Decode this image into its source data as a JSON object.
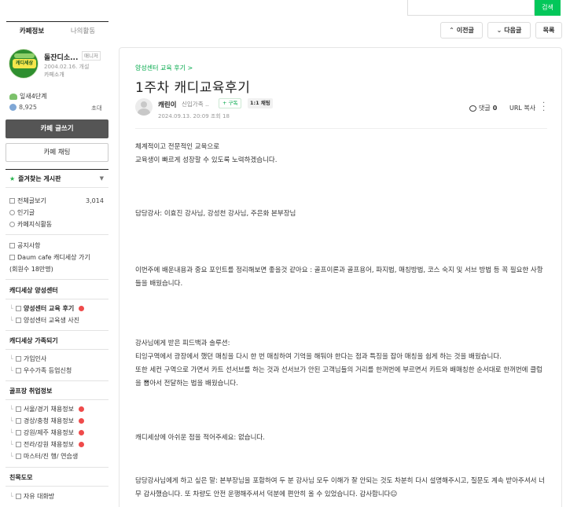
{
  "top": {
    "search_button": "검색",
    "prev_label": "이전글",
    "next_label": "다음글",
    "list_label": "목록"
  },
  "sidebar": {
    "tabs": [
      "카페정보",
      "나의활동"
    ],
    "cafe": {
      "name": "돌잔디소...",
      "badge": "매니저",
      "logo_text": "캐디세상",
      "date": "2004.02.16. 개설",
      "intro": "카페소개"
    },
    "level": "잎새4단계",
    "members": "8,925",
    "invite": "초대",
    "write_button": "카페 글쓰기",
    "chat_button": "카페 채팅",
    "favorites": "즐겨찾는 게시판",
    "menu_top": [
      {
        "label": "전체글보기",
        "count": "3,014"
      },
      {
        "label": "인기글"
      },
      {
        "label": "카페지식활동"
      }
    ],
    "notice": "공지사항",
    "daum": "Daum cafe 캐디세상 가기",
    "daum_sub": "(회원수 18만명)",
    "sections": [
      {
        "title": "캐디세상 양성센터",
        "items": [
          "양성센터 교육 후기",
          "양성센터 교육생 사진"
        ]
      },
      {
        "title": "캐디세상 가족되기",
        "items": [
          "가입인사",
          "우수가족 등업신청"
        ]
      },
      {
        "title": "골프장 취업정보",
        "items": [
          "서울/경기 채용정보",
          "경상/충청 채용정보",
          "강원/제주 채용정보",
          "전라/강원 채용정보",
          "마스터/진 행/ 연습생"
        ]
      },
      {
        "title": "친목도모",
        "items": [
          "자유 대화방"
        ]
      }
    ]
  },
  "article": {
    "board": "양성센터 교육 후기 >",
    "title": "1주차 캐디교육후기",
    "author": "캐린이",
    "rank": "신입가족 ..",
    "follow": "+ 구독",
    "chat": "1:1 채팅",
    "meta": "2024.09.13. 20:09  조회 18",
    "comment_label": "댓글",
    "comment_count": "0",
    "url_copy": "URL 복사",
    "paragraphs": [
      "체계적이고 전문적인 교육으로\n교육생이 빠르게 성장할 수 있도록 노력하겠습니다.",
      "담당강사:  이효진 강사님, 강성천 강사님, 주은화 본부장님",
      "이번주에 배운내용과 중요 포인트를 정리해보면 좋을것 같아요 :  골프이론과 골프용어, 파지법, 매칭방법, 코스 숙지 및 서브 방법 등 꼭 필요한 사항들을 배웠습니다.",
      "강사님에게 받은 피드백과 솔루션:\n티잉구역에서 광장에서 했던 매칭을 다시 한 번 매칭하여 기억을 해둬야 한다는 점과 특징을 잡아 매칭을 쉽게 하는 것을 배웠습니다.\n또한 세컨 구역으로 가면서 카트 선서브를 하는 것과 선서브가 안된 고객님들의 거리를 한꺼번에 부르면서 카트와 배매칭한 순서대로 한꺼번에 클럽을 뽑아서 전달하는 법을 배웠습니다.",
      "캐디세상에 아쉬운 점을 적어주세요: 없습니다.",
      "담당강사님에게 하고 싶은 말: 본부장님을 포함하여 두 분 강사님 모두 이해가 잘 안되는 것도 차분히 다시 설명해주시고, 질문도 계속 받아주셔서 너무 감사했습니다. 또 차량도 안전 운행해주셔서 덕분에 편안히 올 수 있었습니다. 감사합니다☺"
    ]
  }
}
